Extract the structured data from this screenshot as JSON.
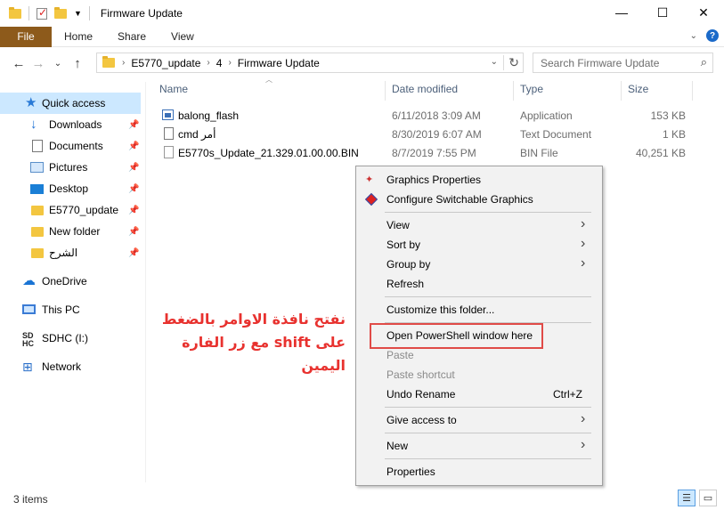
{
  "window": {
    "title": "Firmware Update"
  },
  "ribbon": {
    "tabs": [
      "File",
      "Home",
      "Share",
      "View"
    ]
  },
  "address": {
    "crumbs": [
      "E5770_update",
      "4",
      "Firmware Update"
    ],
    "search_placeholder": "Search Firmware Update"
  },
  "nav": {
    "items": [
      {
        "label": "Quick access",
        "icon": "star-icon",
        "selected": true
      },
      {
        "label": "Downloads",
        "icon": "download-icon",
        "pinned": true
      },
      {
        "label": "Documents",
        "icon": "documents-icon",
        "pinned": true
      },
      {
        "label": "Pictures",
        "icon": "pictures-icon",
        "pinned": true
      },
      {
        "label": "Desktop",
        "icon": "desktop-icon",
        "pinned": true
      },
      {
        "label": "E5770_update",
        "icon": "folder-icon",
        "pinned": true
      },
      {
        "label": "New folder",
        "icon": "folder-icon",
        "pinned": true
      },
      {
        "label": "الشرح",
        "icon": "folder-icon",
        "pinned": true
      },
      {
        "label": "OneDrive",
        "icon": "onedrive-icon"
      },
      {
        "label": "This PC",
        "icon": "computer-icon"
      },
      {
        "label": "SDHC (I:)",
        "icon": "sd-card-icon"
      },
      {
        "label": "Network",
        "icon": "network-icon"
      }
    ]
  },
  "columns": {
    "name": "Name",
    "date": "Date modified",
    "type": "Type",
    "size": "Size"
  },
  "files": [
    {
      "name": "balong_flash",
      "date": "6/11/2018 3:09 AM",
      "type": "Application",
      "size": "153 KB",
      "icon": "application-icon"
    },
    {
      "name": "cmd أمر",
      "date": "8/30/2019 6:07 AM",
      "type": "Text Document",
      "size": "1 KB",
      "icon": "text-file-icon"
    },
    {
      "name": "E5770s_Update_21.329.01.00.00.BIN",
      "date": "8/7/2019 7:55 PM",
      "type": "BIN File",
      "size": "40,251 KB",
      "icon": "bin-file-icon"
    }
  ],
  "annotation": {
    "line1": "نفتح نافذة الاوامر بالضغط",
    "line2": "على shift مع زر الفارة اليمين"
  },
  "context_menu": {
    "graphics_properties": "Graphics Properties",
    "configure_graphics": "Configure Switchable Graphics",
    "view": "View",
    "sort_by": "Sort by",
    "group_by": "Group by",
    "refresh": "Refresh",
    "customize": "Customize this folder...",
    "open_powershell": "Open PowerShell window here",
    "paste": "Paste",
    "paste_shortcut": "Paste shortcut",
    "undo_rename": "Undo Rename",
    "undo_shortcut": "Ctrl+Z",
    "give_access": "Give access to",
    "new": "New",
    "properties": "Properties"
  },
  "status": {
    "count": "3 items"
  },
  "colors": {
    "file_tab": "#8d5a1b",
    "selected_nav": "#cce8ff",
    "highlight_box": "#e04b47",
    "annotation": "#e8322f"
  }
}
